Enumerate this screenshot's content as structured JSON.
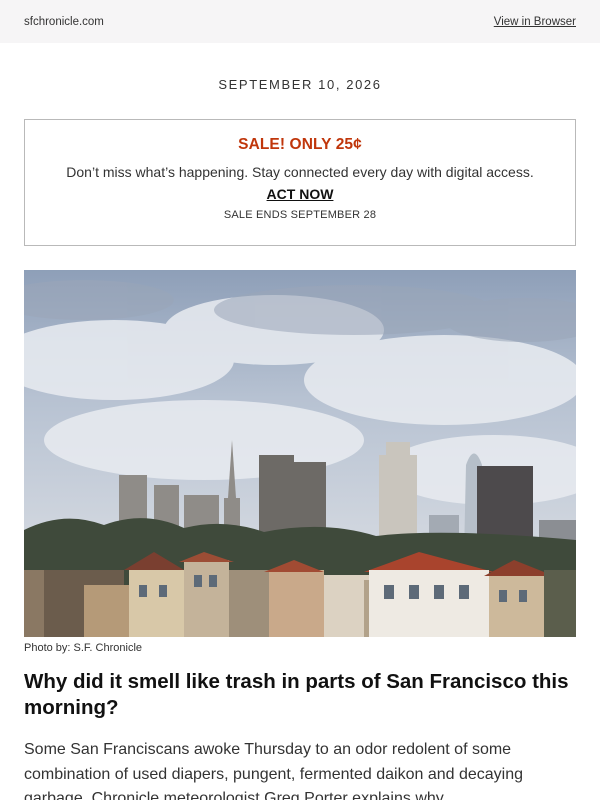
{
  "header": {
    "site": "sfchronicle.com",
    "view_in_browser": "View in Browser"
  },
  "date": "SEPTEMBER 10, 2026",
  "promo": {
    "title": "SALE! ONLY 25¢",
    "message": "Don’t miss what’s happening. Stay connected every day with digital access.",
    "cta": "ACT NOW",
    "ends": "SALE ENDS SEPTEMBER 28",
    "accent_color": "#c0360b"
  },
  "article": {
    "image_icon": "skyline-photo",
    "photo_credit": "Photo by: S.F. Chronicle",
    "headline": "Why did it smell like trash in parts of San Francisco this morning?",
    "body": "Some San Franciscans awoke Thursday to an odor redolent of some combination of used diapers, pungent, fermented daikon and decaying garbage. Chronicle meteorologist Greg Porter explains why."
  }
}
